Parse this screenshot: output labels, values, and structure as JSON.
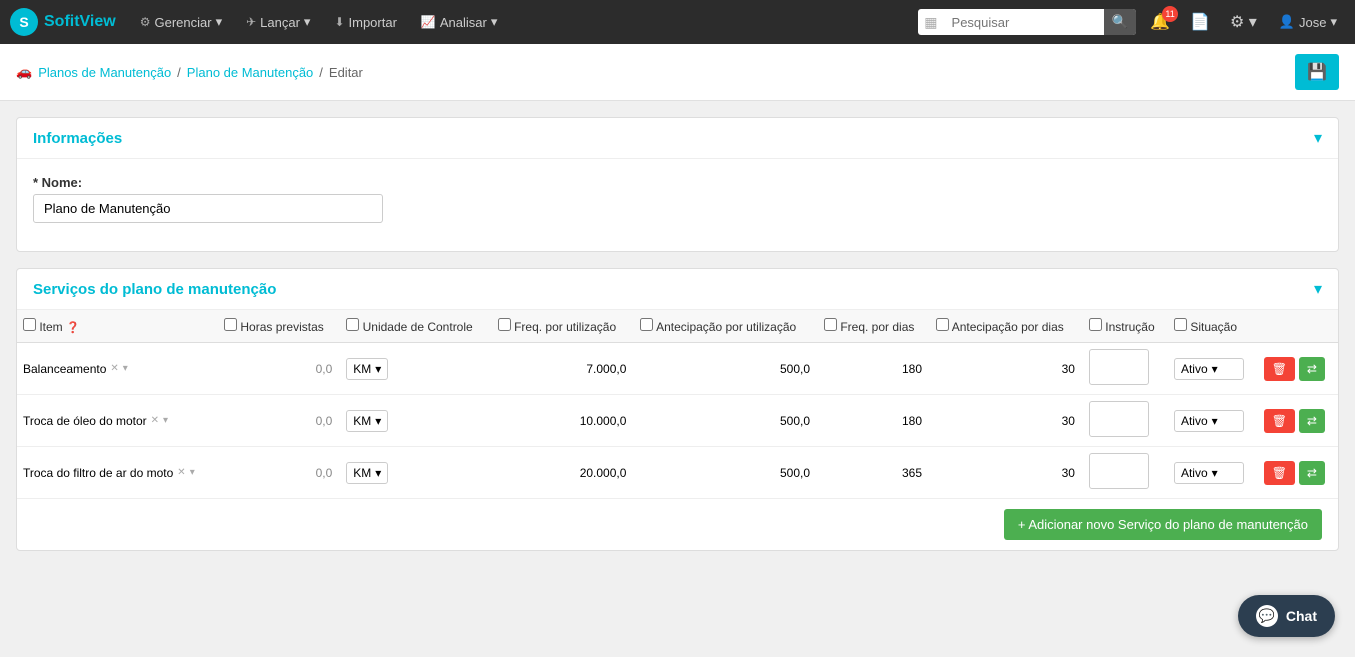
{
  "brand": {
    "logo_char": "S",
    "name_part1": "Sofit",
    "name_part2": "View"
  },
  "navbar": {
    "items": [
      {
        "label": "Gerenciar",
        "icon": "⚙"
      },
      {
        "label": "Lançar",
        "icon": "✈"
      },
      {
        "label": "Importar",
        "icon": "⬇"
      },
      {
        "label": "Analisar",
        "icon": "📈"
      }
    ],
    "search_placeholder": "Pesquisar",
    "notification_count": "11",
    "user_label": "Jose"
  },
  "breadcrumb": {
    "link1": "Planos de Manutenção",
    "link2": "Plano de Manutenção",
    "current": "Editar"
  },
  "info_section": {
    "title": "Informações",
    "name_label": "* Nome:",
    "name_value": "Plano de Manutenção"
  },
  "services_section": {
    "title": "Serviços do plano de manutenção",
    "columns": {
      "item": "Item",
      "horas": "Horas previstas",
      "unidade": "Unidade de Controle",
      "freq_util": "Freq. por utilização",
      "antecip_util": "Antecipação por utilização",
      "freq_dias": "Freq. por dias",
      "antecip_dias": "Antecipação por dias",
      "instrucao": "Instrução",
      "situacao": "Situação"
    },
    "rows": [
      {
        "item": "Balanceamento",
        "horas": "0,0",
        "unidade": "KM",
        "freq_util": "7.000,0",
        "antecip_util": "500,0",
        "freq_dias": "180",
        "antecip_dias": "30",
        "instrucao": "",
        "situacao": "Ativo"
      },
      {
        "item": "Troca de óleo do motor",
        "horas": "0,0",
        "unidade": "KM",
        "freq_util": "10.000,0",
        "antecip_util": "500,0",
        "freq_dias": "180",
        "antecip_dias": "30",
        "instrucao": "",
        "situacao": "Ativo"
      },
      {
        "item": "Troca do filtro de ar do moto",
        "horas": "0,0",
        "unidade": "KM",
        "freq_util": "20.000,0",
        "antecip_util": "500,0",
        "freq_dias": "365",
        "antecip_dias": "30",
        "instrucao": "",
        "situacao": "Ativo"
      }
    ],
    "add_btn": "+ Adicionar novo Serviço do plano de manutenção"
  },
  "chat": {
    "label": "Chat"
  }
}
